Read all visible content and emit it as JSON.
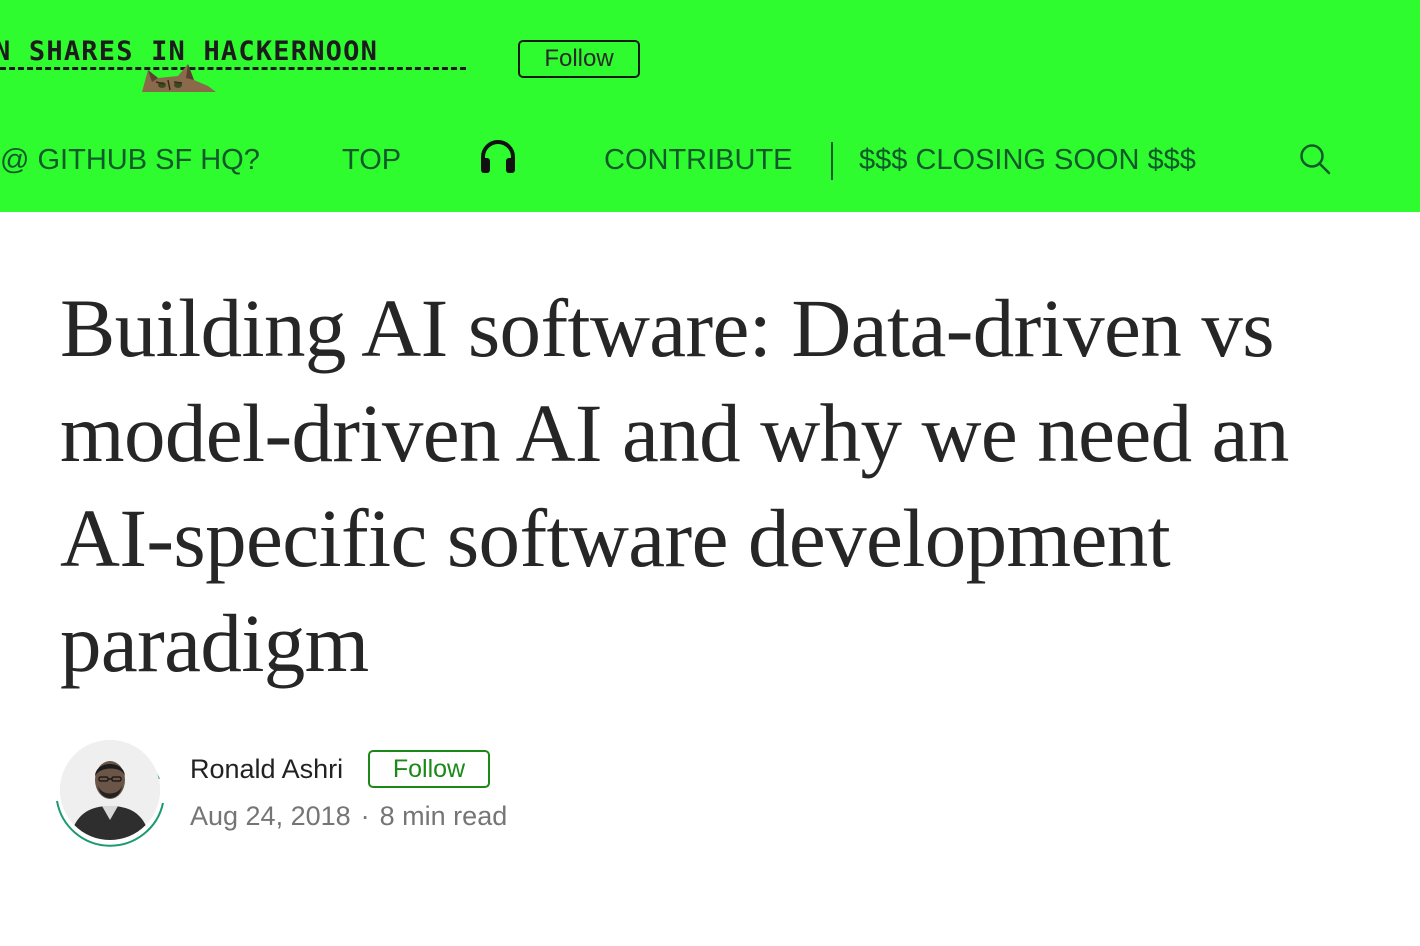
{
  "header": {
    "publication_logo_text": "N SHARES IN HACKERNOON",
    "follow_label": "Follow",
    "background_color": "#2efc2e",
    "nav": [
      {
        "label": "@ GITHUB SF HQ?"
      },
      {
        "label": "TOP"
      },
      {
        "icon": "headphones-icon"
      },
      {
        "label": "CONTRIBUTE"
      },
      {
        "label": "$$$ CLOSING SOON $$$"
      },
      {
        "icon": "search-icon"
      }
    ]
  },
  "article": {
    "title": "Building AI software: Data-driven vs model-driven AI and why we need an AI-specific software development paradigm",
    "author": {
      "name": "Ronald Ashri",
      "follow_label": "Follow",
      "avatar_icon": "author-avatar"
    },
    "date": "Aug 24, 2018",
    "separator": "·",
    "read_time": "8 min read"
  },
  "colors": {
    "follow_accent": "#1a8917",
    "title_text": "#262626",
    "meta_text": "#757575",
    "nav_text": "#0f5a2a"
  }
}
